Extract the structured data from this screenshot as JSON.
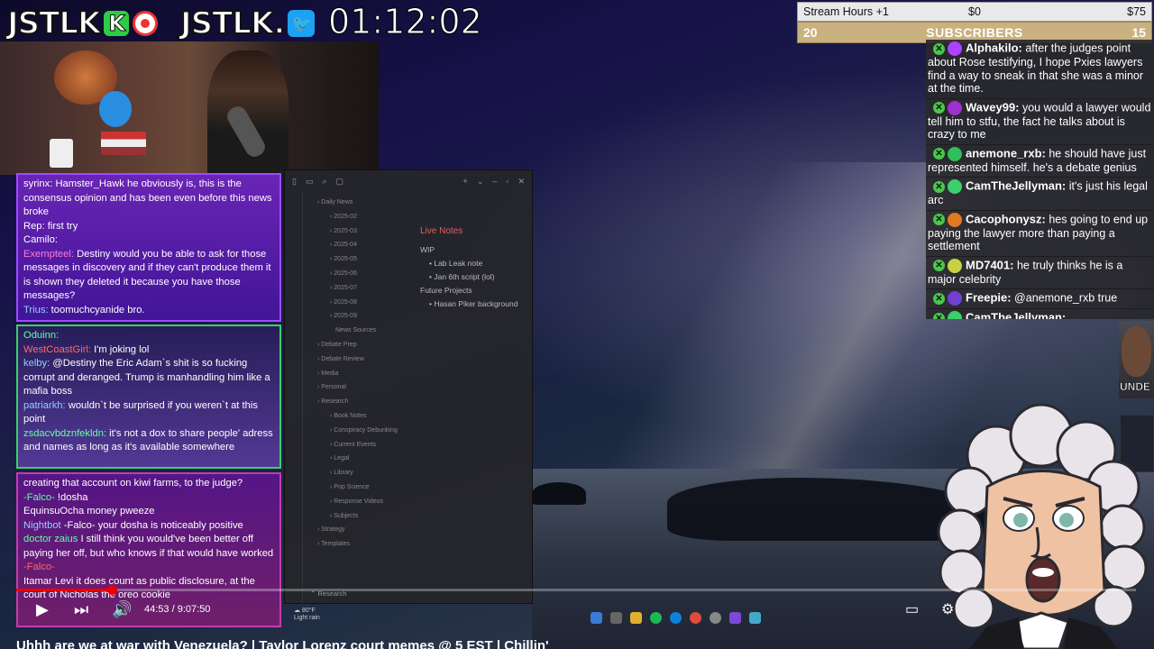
{
  "header": {
    "logo_text_1": "JSTLK",
    "logo_badge_1": "K",
    "logo_text_2": "JSTLK.",
    "timer": "01:12:02"
  },
  "stats": {
    "label": "Stream Hours +1",
    "amount": "$0",
    "goal": "$75",
    "sub_left": "20",
    "sub_label": "SUBSCRIBERS",
    "sub_right": "15"
  },
  "chat": [
    {
      "user": "Alphakilo:",
      "text": "after the judges point about Rose testifying, I hope Pxies lawyers find a way to sneak in that she was a minor at the time.",
      "color": "#b040ff"
    },
    {
      "user": "Wavey99:",
      "text": "you would a lawyer would tell him to stfu, the fact he talks about is crazy to me",
      "color": "#a030d0"
    },
    {
      "user": "anemone_rxb:",
      "text": "he should have just represented himself. he's a debate genius",
      "color": "#2fbf5a"
    },
    {
      "user": "CamTheJellyman:",
      "text": "it's just his legal arc",
      "color": "#3ccf6a"
    },
    {
      "user": "Cacophonysz:",
      "text": "hes going to end up paying the lawyer more than paying a settlement",
      "color": "#e07a20"
    },
    {
      "user": "MD7401:",
      "text": "he truly thinks he is a major celebrity",
      "color": "#c8d040"
    },
    {
      "user": "Freepie:",
      "text": "@anemone_rxb true",
      "color": "#7040d0"
    },
    {
      "user": "CamTheJellyman:",
      "text": "",
      "color": "#3ccf6a"
    }
  ],
  "left_chat": {
    "box1": [
      {
        "user": "syrinx:",
        "text": "Hamster_Hawk he obviously is, this is the consensus opinion and has been even before this news broke",
        "cls": ""
      },
      {
        "user": "Rep:",
        "text": "first try",
        "cls": ""
      },
      {
        "user": "Camilo:",
        "text": "",
        "cls": ""
      },
      {
        "user": "Exempteel:",
        "text": "Destiny would you be able to ask for those messages in discovery and if they can't produce them it is shown they deleted it because you have those messages?",
        "cls": "u1"
      },
      {
        "user": "Trius:",
        "text": "toomuchcyanide bro.",
        "cls": "u3"
      }
    ],
    "box2": [
      {
        "user": "Oduinn:",
        "text": "",
        "cls": "u2"
      },
      {
        "user": "WestCoastGirl:",
        "text": "I'm joking lol",
        "cls": "u6"
      },
      {
        "user": "kelby:",
        "text": "@Destiny the Eric Adam`s shit is so fucking corrupt and deranged. Trump is manhandling him like a mafia boss",
        "cls": "u3"
      },
      {
        "user": "patriarkh:",
        "text": "wouldn`t be surprised if you weren`t at this point",
        "cls": "u3"
      },
      {
        "user": "zsdacvbdznfekldn:",
        "text": "it's not a dox to share people' adress and names as long as it's available somewhere",
        "cls": "u2"
      }
    ],
    "box3": [
      {
        "user": "",
        "text": "creating that account on kiwi farms, to the judge?",
        "cls": ""
      },
      {
        "user": "-Falco-",
        "text": "!dosha",
        "cls": "u2"
      },
      {
        "user": "EquinsuOcha",
        "text": "money pweeze",
        "cls": ""
      },
      {
        "user": "Nightbot",
        "text": "-Falco- your dosha is noticeably positive",
        "cls": "u3"
      },
      {
        "user": "doctor zaius",
        "text": "I still think you would've been better off paying her off, but who knows if that would have worked",
        "cls": "u2"
      },
      {
        "user": "-Falco-",
        "text": "",
        "cls": "u6"
      },
      {
        "user": "Itamar Levi",
        "text": "it does count as public disclosure, at the court of Nicholas the oreo cookie",
        "cls": ""
      }
    ]
  },
  "obsidian": {
    "tree": [
      {
        "label": "Daily News",
        "depth": 1
      },
      {
        "label": "2025-02",
        "depth": 2
      },
      {
        "label": "2025-03",
        "depth": 2
      },
      {
        "label": "2025-04",
        "depth": 2
      },
      {
        "label": "2025-05",
        "depth": 2
      },
      {
        "label": "2025-06",
        "depth": 2
      },
      {
        "label": "2025-07",
        "depth": 2
      },
      {
        "label": "2025-08",
        "depth": 2
      },
      {
        "label": "2025-09",
        "depth": 2
      },
      {
        "label": "News Sources",
        "depth": 3
      },
      {
        "label": "Debate Prep",
        "depth": 1
      },
      {
        "label": "Debate Review",
        "depth": 1
      },
      {
        "label": "Media",
        "depth": 1
      },
      {
        "label": "Personal",
        "depth": 1
      },
      {
        "label": "Research",
        "depth": 1
      },
      {
        "label": "Book Notes",
        "depth": 2
      },
      {
        "label": "Conspiracy Debunking",
        "depth": 2
      },
      {
        "label": "Current Events",
        "depth": 2
      },
      {
        "label": "Legal",
        "depth": 2
      },
      {
        "label": "Library",
        "depth": 2
      },
      {
        "label": "Pop Science",
        "depth": 2
      },
      {
        "label": "Response Videos",
        "depth": 2
      },
      {
        "label": "Subjects",
        "depth": 2
      },
      {
        "label": "Strategy",
        "depth": 1
      },
      {
        "label": "Templates",
        "depth": 1
      }
    ],
    "note_title": "Live Notes",
    "note_lines": [
      {
        "text": "WIP",
        "indent": false
      },
      {
        "text": "Lab Leak note",
        "indent": true
      },
      {
        "text": "Jan 6th script (lol)",
        "indent": true
      },
      {
        "text": "Future Projects",
        "indent": false
      },
      {
        "text": "Hasan Piker background",
        "indent": true
      }
    ],
    "bottom_label": "Research"
  },
  "player": {
    "progress": 0.0862,
    "time": "44:53 / 9:07:50",
    "title": "Uhhh are we at war with Venezuela? | Taylor Lorenz court memes @ 5 EST | Chillin'"
  },
  "thumb": {
    "text": "UNDE"
  },
  "weather": {
    "temp": "80°F",
    "desc": "Light rain"
  }
}
